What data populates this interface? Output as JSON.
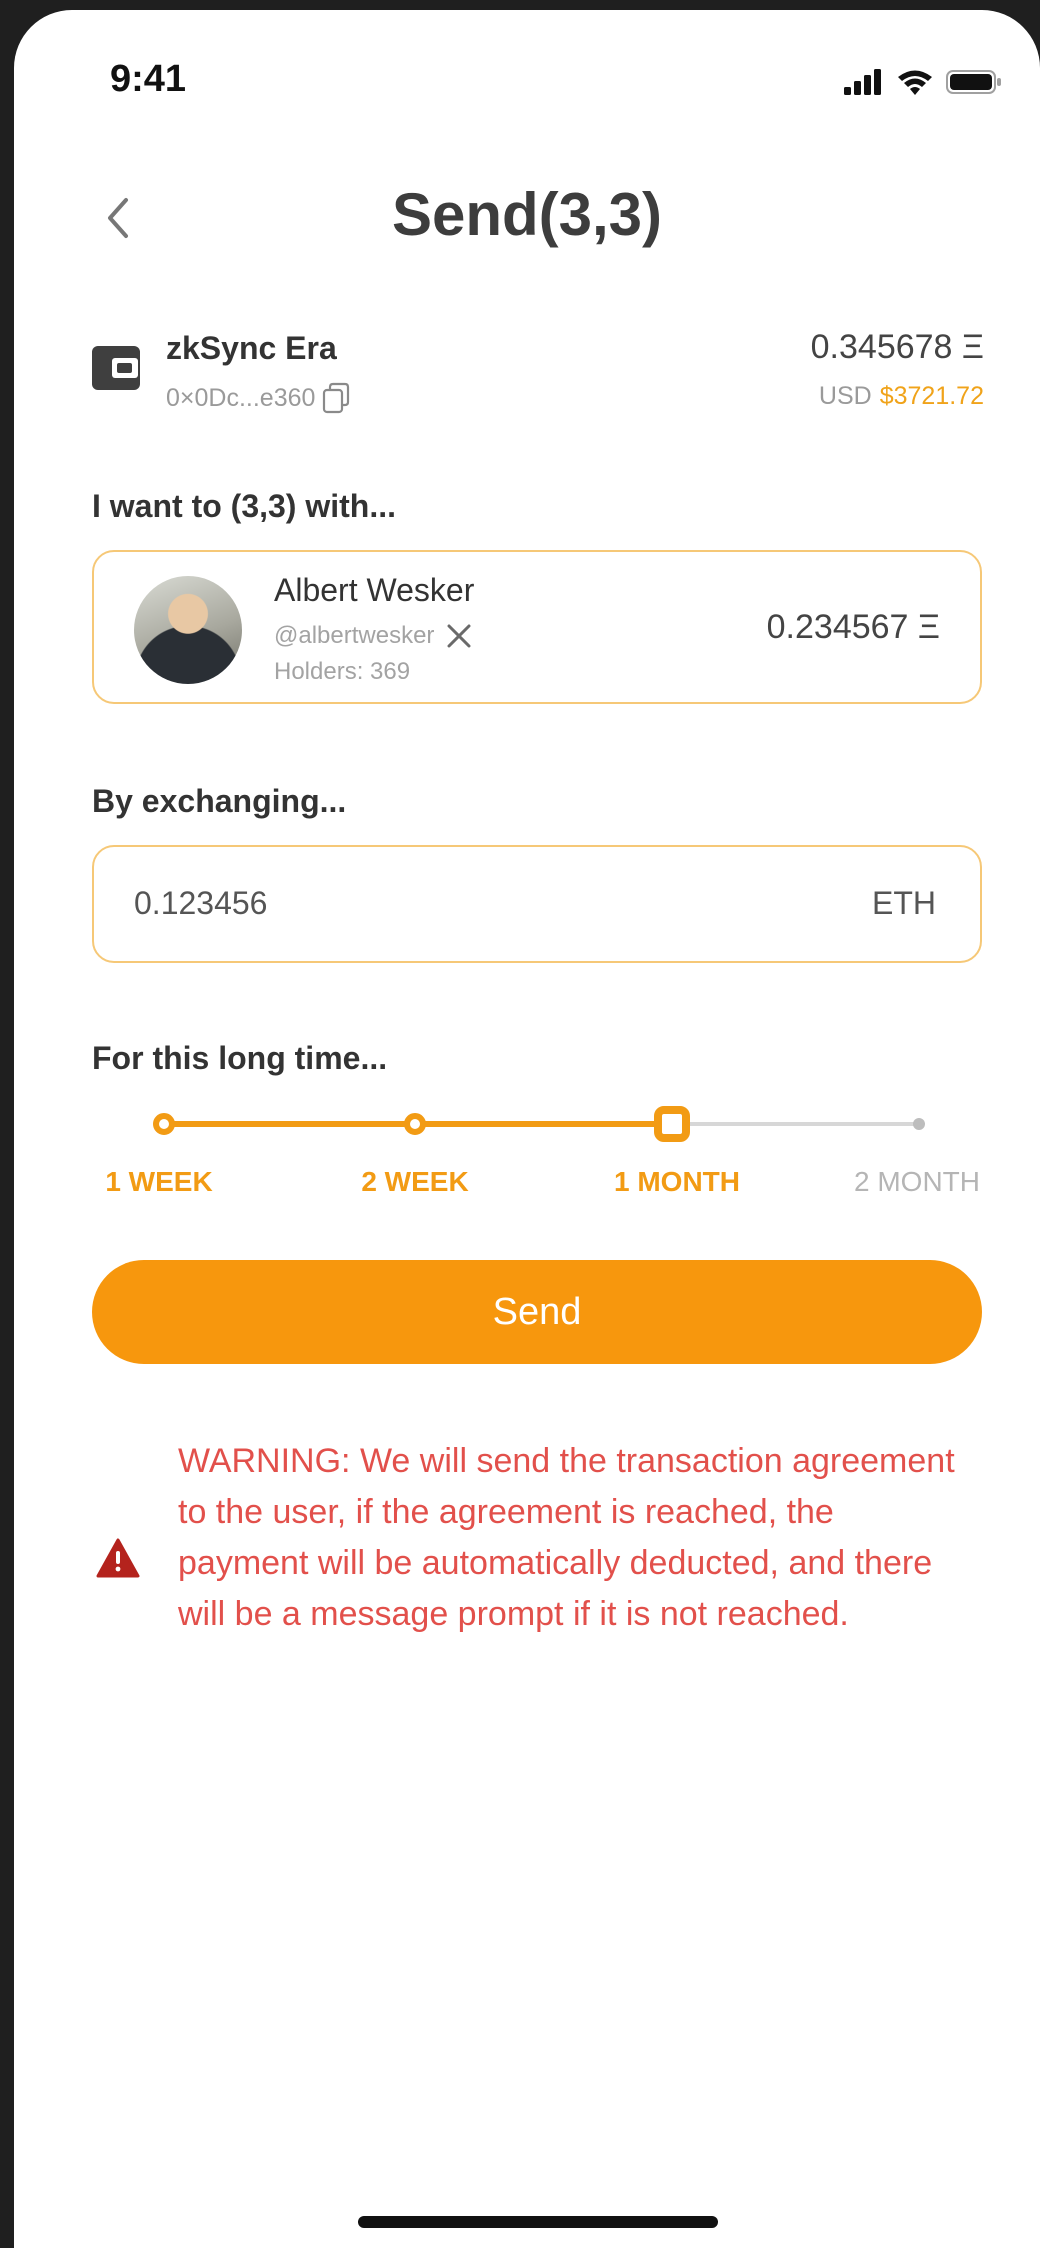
{
  "status_bar": {
    "time": "9:41"
  },
  "header": {
    "title": "Send(3,3)"
  },
  "wallet": {
    "name": "zkSync Era",
    "address": "0×0Dc...e360",
    "balance": "0.345678 Ξ",
    "usd_label": "USD",
    "usd_value": "$3721.72"
  },
  "target": {
    "label": "I want to (3,3) with...",
    "name": "Albert Wesker",
    "handle": "@albertwesker",
    "holders": "Holders: 369",
    "amount": "0.234567 Ξ"
  },
  "exchange": {
    "label": "By exchanging...",
    "value": "0.123456",
    "unit": "ETH"
  },
  "duration": {
    "label": "For this long time...",
    "options": [
      "1 WEEK",
      "2 WEEK",
      "1 MONTH",
      "2 MONTH"
    ],
    "selected": "1 MONTH"
  },
  "send_label": "Send",
  "warning": "WARNING: We will send the transaction agreement to the user, if the agreement is reached, the payment will be automatically deducted, and there will be a message prompt if it is not reached.",
  "colors": {
    "accent": "#f7970d",
    "border": "#f6c877",
    "warning": "#e2504b",
    "usd": "#f0a31a"
  },
  "icons": [
    "back-chevron-icon",
    "wallet-icon",
    "copy-icon",
    "x-logo-icon",
    "warning-triangle-icon",
    "signal-icon",
    "wifi-icon",
    "battery-icon"
  ]
}
